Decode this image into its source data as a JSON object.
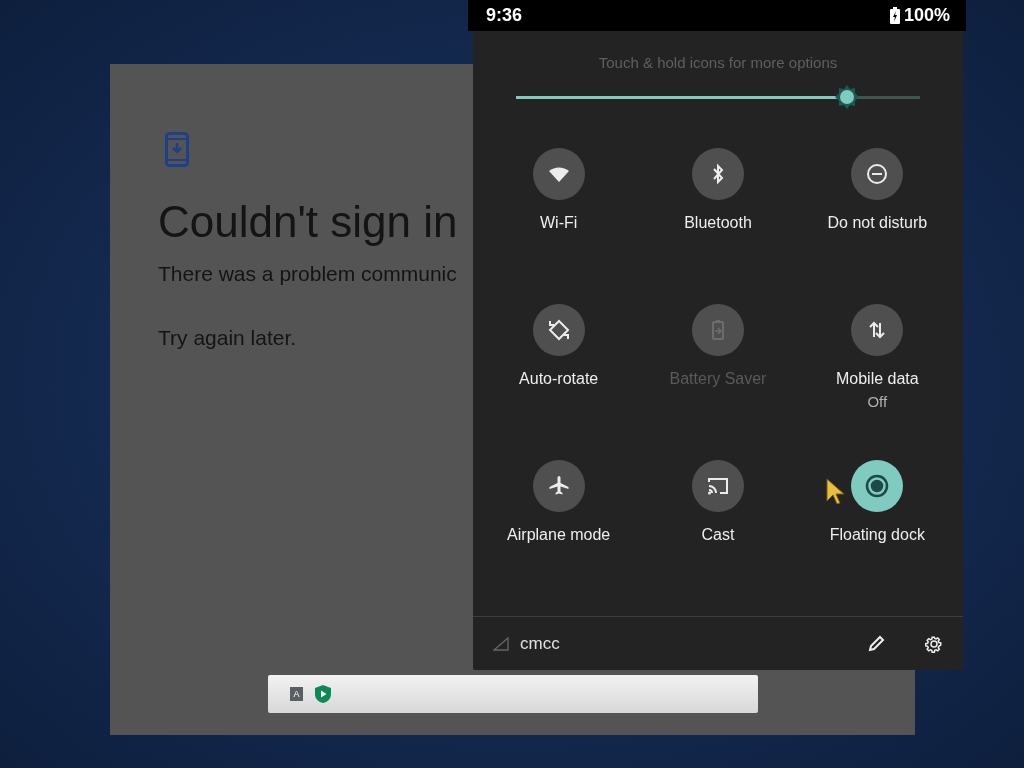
{
  "dialog": {
    "title": "Couldn't sign in",
    "message": "There was a problem communic",
    "hint": "Try again later."
  },
  "taskbar": {
    "keyboard_label": "A"
  },
  "status_bar": {
    "time": "9:36",
    "battery": "100%"
  },
  "quick_settings": {
    "hint": "Touch & hold icons for more options",
    "brightness": {
      "level": 0.82
    },
    "tiles": [
      {
        "kind": "wifi",
        "label": "Wi-Fi",
        "on": false,
        "disabled": false
      },
      {
        "kind": "bluetooth",
        "label": "Bluetooth",
        "on": false,
        "disabled": false
      },
      {
        "kind": "dnd",
        "label": "Do not disturb",
        "on": false,
        "disabled": false
      },
      {
        "kind": "rotate",
        "label": "Auto-rotate",
        "on": false,
        "disabled": false
      },
      {
        "kind": "battery",
        "label": "Battery Saver",
        "on": false,
        "disabled": true
      },
      {
        "kind": "data",
        "label": "Mobile data",
        "secondary": "Off",
        "on": false,
        "disabled": false
      },
      {
        "kind": "airplane",
        "label": "Airplane mode",
        "on": false,
        "disabled": false
      },
      {
        "kind": "cast",
        "label": "Cast",
        "on": false,
        "disabled": false
      },
      {
        "kind": "dock",
        "label": "Floating dock",
        "on": true,
        "disabled": false
      }
    ],
    "carrier": "cmcc"
  }
}
